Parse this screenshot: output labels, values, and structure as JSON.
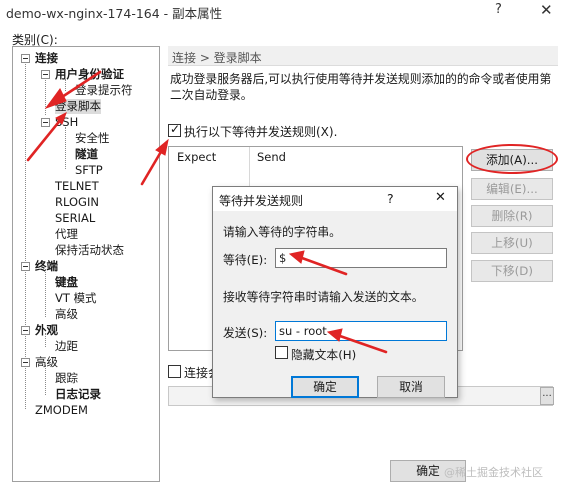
{
  "window": {
    "title": "demo-wx-nginx-174-164 - 副本属性",
    "help_icon": "?",
    "close_icon": "✕"
  },
  "category": {
    "label": "类别(C):",
    "nodes": [
      {
        "label": "连接",
        "bold": true
      },
      {
        "label": "用户身份验证",
        "bold": true
      },
      {
        "label": "登录提示符",
        "bold": false
      },
      {
        "label": "登录脚本",
        "bold": false
      },
      {
        "label": "SSH",
        "bold": false
      },
      {
        "label": "安全性",
        "bold": false
      },
      {
        "label": "隧道",
        "bold": true
      },
      {
        "label": "SFTP",
        "bold": false
      },
      {
        "label": "TELNET",
        "bold": false
      },
      {
        "label": "RLOGIN",
        "bold": false
      },
      {
        "label": "SERIAL",
        "bold": false
      },
      {
        "label": "代理",
        "bold": false
      },
      {
        "label": "保持活动状态",
        "bold": false
      },
      {
        "label": "终端",
        "bold": true
      },
      {
        "label": "键盘",
        "bold": true
      },
      {
        "label": "VT 模式",
        "bold": false
      },
      {
        "label": "高级",
        "bold": false
      },
      {
        "label": "外观",
        "bold": true
      },
      {
        "label": "边距",
        "bold": false
      },
      {
        "label": "高级",
        "bold": false
      },
      {
        "label": "跟踪",
        "bold": false
      },
      {
        "label": "日志记录",
        "bold": true
      },
      {
        "label": "ZMODEM",
        "bold": false
      }
    ]
  },
  "panel": {
    "breadcrumb": "连接 > 登录脚本",
    "description": "成功登录服务器后,可以执行使用等待并发送规则添加的的命令或者使用第二次自动登录。",
    "execute_rules_label": "执行以下等待并发送规则(X).",
    "execute_rules_checked": true,
    "columns": [
      "Expect",
      "Send"
    ],
    "buttons": {
      "add": "添加(A)...",
      "edit": "编辑(E)...",
      "delete": "删除(R)",
      "up": "上移(U)",
      "down": "下移(D)"
    },
    "connect_label": "连接会",
    "connect_checked": false,
    "browse": "..."
  },
  "dialog": {
    "title": "等待并发送规则",
    "help_icon": "?",
    "close_icon": "✕",
    "prompt_wait": "请输入等待的字符串。",
    "wait_label": "等待(E):",
    "wait_value": "$",
    "prompt_send": "接收等待字符串时请输入发送的文本。",
    "send_label": "发送(S):",
    "send_value": "su - root",
    "hide_text_label": "隐藏文本(H)",
    "hide_text_checked": false,
    "ok": "确定",
    "cancel": "取消"
  },
  "footer": {
    "ok": "确定",
    "watermark": "@稀土掘金技术社区"
  },
  "colors": {
    "annotation_red": "#e02424",
    "focus_blue": "#0078d7"
  }
}
